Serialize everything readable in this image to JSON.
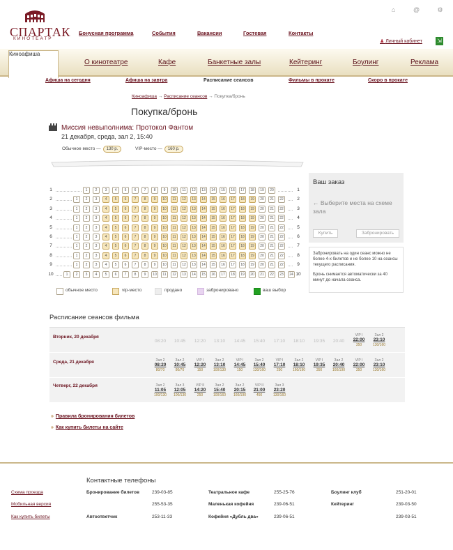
{
  "logo": {
    "name": "СПАРТАК",
    "sub": "КИНОТЕАТР"
  },
  "topnav": [
    "Бонусная программа",
    "События",
    "Вакансии",
    "Гостевая",
    "Контакты"
  ],
  "cabinet": "Личный кабинет",
  "mainnav": {
    "active": "Киноафиша",
    "items": [
      "О кинотеатре",
      "Кафе",
      "Банкетные залы",
      "Кейтеринг",
      "Боулинг",
      "Реклама"
    ]
  },
  "subnav": [
    "Афиша на сегодня",
    "Афиша на завтра",
    "Расписание сеансов",
    "Фильмы в прокате",
    "Скоро в прокате"
  ],
  "breadcrumb": {
    "a": "Киноафиша",
    "b": "Расписание сеансов",
    "c": "Покупка/бронь",
    "sep": "→"
  },
  "page_title": "Покупка/бронь",
  "movie": {
    "title": "Миссия невыполнима: Протокол Фантом",
    "when": "21 декабря, среда, зал 2, 15:40"
  },
  "prices": {
    "normal_label": "Обычное место —",
    "normal": "130 р.",
    "vip_label": "VIP-место —",
    "vip": "160 р."
  },
  "rows": [
    {
      "n": "1",
      "seats": 20
    },
    {
      "n": "2",
      "seats": 22
    },
    {
      "n": "3",
      "seats": 22
    },
    {
      "n": "4",
      "seats": 22
    },
    {
      "n": "5",
      "seats": 22
    },
    {
      "n": "6",
      "seats": 22
    },
    {
      "n": "7",
      "seats": 22
    },
    {
      "n": "8",
      "seats": 22
    },
    {
      "n": "9",
      "seats": 22
    },
    {
      "n": "10",
      "seats": 24
    }
  ],
  "legend": [
    "обычное место",
    "vip-место",
    "продано",
    "забронировано",
    "ваш выбор"
  ],
  "legend_colors": [
    "#ffffff",
    "#f6e6bc",
    "#eeeeee",
    "#e8d4f0",
    "#22a022"
  ],
  "order": {
    "title": "Ваш заказ",
    "msg": "← Выберите места на схеме зала",
    "buy": "Купить",
    "reserve": "Забронировать"
  },
  "note": {
    "p1": "Забронировать на один сеанс можно не более 4-х билетов и не более 10 на сеансы текущего расписания.",
    "p2": "Бронь снимается автоматически за 40 минут до начала сеанса."
  },
  "schedule_title": "Расписание сеансов фильма",
  "schedule": [
    {
      "day": "Вторник, 20 декабря",
      "cells": [
        {
          "hall": "",
          "time": "08:20",
          "price": "",
          "past": true
        },
        {
          "hall": "",
          "time": "10:45",
          "price": "",
          "past": true
        },
        {
          "hall": "",
          "time": "12:20",
          "price": "",
          "past": true
        },
        {
          "hall": "",
          "time": "13:10",
          "price": "",
          "past": true
        },
        {
          "hall": "",
          "time": "14:45",
          "price": "",
          "past": true
        },
        {
          "hall": "",
          "time": "15:40",
          "price": "",
          "past": true
        },
        {
          "hall": "",
          "time": "17:10",
          "price": "",
          "past": true
        },
        {
          "hall": "",
          "time": "18:10",
          "price": "",
          "past": true
        },
        {
          "hall": "",
          "time": "19:35",
          "price": "",
          "past": true
        },
        {
          "hall": "",
          "time": "20:40",
          "price": "",
          "past": true
        },
        {
          "hall": "VIP I",
          "time": "22:00",
          "price": "350",
          "past": false
        },
        {
          "hall": "Зал 2",
          "time": "23:10",
          "price": "130/160",
          "past": false
        }
      ]
    },
    {
      "day": "Среда, 21 декабря",
      "cells": [
        {
          "hall": "Зал 2",
          "time": "08:20",
          "price": "80/70",
          "past": false
        },
        {
          "hall": "Зал 2",
          "time": "10:45",
          "price": "80/70",
          "past": false
        },
        {
          "hall": "VIP I",
          "time": "12:20",
          "price": "150",
          "past": false
        },
        {
          "hall": "Зал 2",
          "time": "13:10",
          "price": "100/130",
          "past": false
        },
        {
          "hall": "VIP I",
          "time": "14:45",
          "price": "150",
          "past": false
        },
        {
          "hall": "Зал 2",
          "time": "15:40",
          "price": "130/160",
          "past": false
        },
        {
          "hall": "VIP I",
          "time": "17:10",
          "price": "250",
          "past": false
        },
        {
          "hall": "Зал 2",
          "time": "18:10",
          "price": "160/190",
          "past": false
        },
        {
          "hall": "VIP I",
          "time": "19:35",
          "price": "350",
          "past": false
        },
        {
          "hall": "Зал 2",
          "time": "20:40",
          "price": "160/190",
          "past": false
        },
        {
          "hall": "VIP I",
          "time": "22:00",
          "price": "350",
          "past": false
        },
        {
          "hall": "Зал 2",
          "time": "23:10",
          "price": "130/160",
          "past": false
        }
      ]
    },
    {
      "day": "Четверг, 22 декабря",
      "cells": [
        {
          "hall": "Зал 2",
          "time": "11:05",
          "price": "100/130",
          "past": false
        },
        {
          "hall": "Зал 3",
          "time": "12:05",
          "price": "100/130",
          "past": false
        },
        {
          "hall": "VIP II",
          "time": "14:20",
          "price": "250",
          "past": false
        },
        {
          "hall": "Зал 2",
          "time": "15:40",
          "price": "100/160",
          "past": false
        },
        {
          "hall": "Зал 2",
          "time": "20:15",
          "price": "160/190",
          "past": false
        },
        {
          "hall": "VIP II",
          "time": "21:00",
          "price": "450",
          "past": false
        },
        {
          "hall": "Зал 3",
          "time": "23:20",
          "price": "130/160",
          "past": false
        }
      ]
    }
  ],
  "rules": [
    "Правила бронирования билетов",
    "Как купить билеты на сайте"
  ],
  "footer": {
    "title": "Контактные телефоны",
    "links": [
      "Схема проезда",
      "Мобильная версия",
      "Как купить билеты"
    ],
    "c1": [
      {
        "n": "Бронирование билетов",
        "v": "239-03-85"
      },
      {
        "n": "",
        "v": "255-53-35"
      },
      {
        "n": "Автоответчик",
        "v": "253-11-33"
      }
    ],
    "c2": [
      {
        "n": "Театральное кафе",
        "v": "255-25-76"
      },
      {
        "n": "Маленькая кофейня",
        "v": "239-06-51"
      },
      {
        "n": "Кофейня «Дубль два»",
        "v": "239-06-51"
      }
    ],
    "c3": [
      {
        "n": "Боулинг клуб",
        "v": "251-20-01"
      },
      {
        "n": "Кейтеринг",
        "v": "239-03-50"
      },
      {
        "n": "",
        "v": "239-03-51"
      }
    ]
  }
}
